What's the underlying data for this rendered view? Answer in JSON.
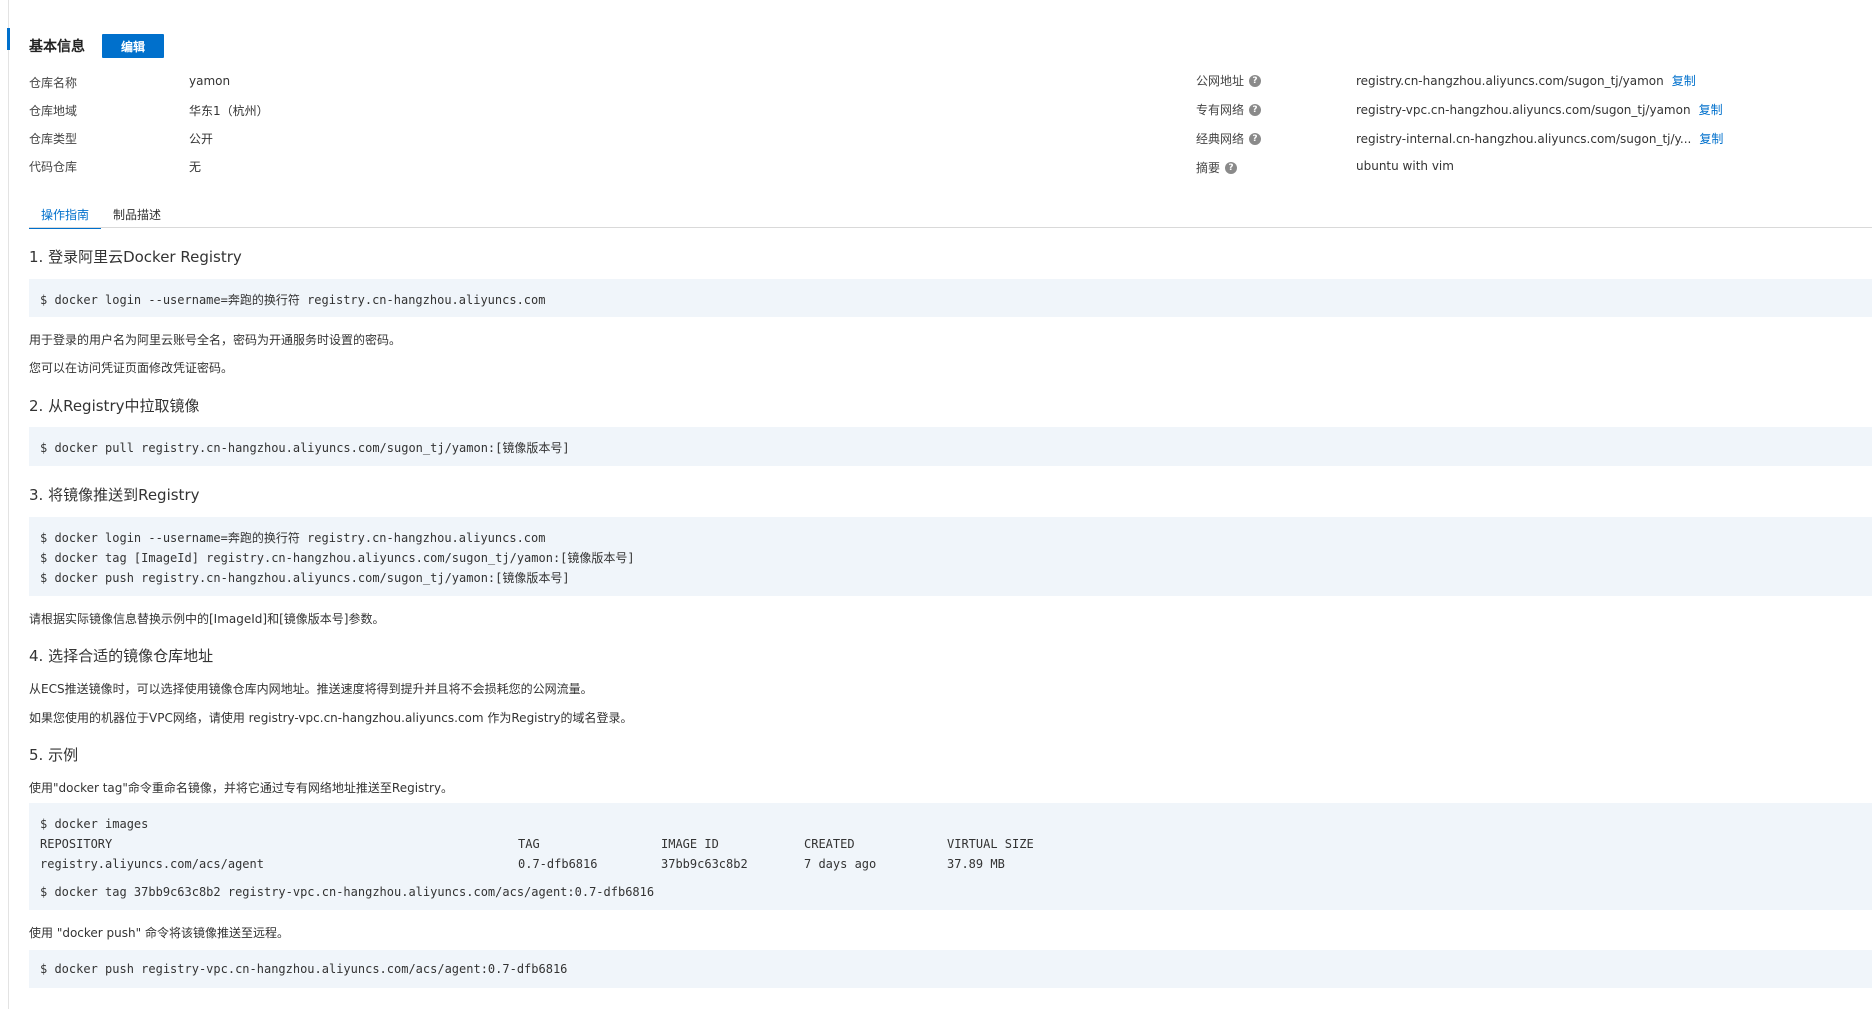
{
  "header": {
    "title": "基本信息",
    "edit_label": "编辑"
  },
  "info_left": [
    {
      "label": "仓库名称",
      "value": "yamon"
    },
    {
      "label": "仓库地域",
      "value": "华东1（杭州）"
    },
    {
      "label": "仓库类型",
      "value": "公开"
    },
    {
      "label": "代码仓库",
      "value": "无"
    }
  ],
  "info_right": [
    {
      "label": "公网地址",
      "value": "registry.cn-hangzhou.aliyuncs.com/sugon_tj/yamon",
      "copy": "复制"
    },
    {
      "label": "专有网络",
      "value": "registry-vpc.cn-hangzhou.aliyuncs.com/sugon_tj/yamon",
      "copy": "复制"
    },
    {
      "label": "经典网络",
      "value": "registry-internal.cn-hangzhou.aliyuncs.com/sugon_tj/y...",
      "copy": "复制"
    },
    {
      "label": "摘要",
      "value": "ubuntu with vim"
    }
  ],
  "help_glyph": "?",
  "tabs": [
    {
      "label": "操作指南"
    },
    {
      "label": "制品描述"
    }
  ],
  "guide": {
    "s1": {
      "title": "1. 登录阿里云Docker Registry",
      "code": "$ docker login --username=奔跑的换行符 registry.cn-hangzhou.aliyuncs.com",
      "p1": "用于登录的用户名为阿里云账号全名，密码为开通服务时设置的密码。",
      "p2": "您可以在访问凭证页面修改凭证密码。"
    },
    "s2": {
      "title": "2. 从Registry中拉取镜像",
      "code": "$ docker pull registry.cn-hangzhou.aliyuncs.com/sugon_tj/yamon:[镜像版本号]"
    },
    "s3": {
      "title": "3. 将镜像推送到Registry",
      "code1": "$ docker login --username=奔跑的换行符 registry.cn-hangzhou.aliyuncs.com",
      "code2": "$ docker tag [ImageId] registry.cn-hangzhou.aliyuncs.com/sugon_tj/yamon:[镜像版本号]",
      "code3": "$ docker push registry.cn-hangzhou.aliyuncs.com/sugon_tj/yamon:[镜像版本号]",
      "p1": "请根据实际镜像信息替换示例中的[ImageId]和[镜像版本号]参数。"
    },
    "s4": {
      "title": "4. 选择合适的镜像仓库地址",
      "p1": "从ECS推送镜像时，可以选择使用镜像仓库内网地址。推送速度将得到提升并且将不会损耗您的公网流量。",
      "p2": "如果您使用的机器位于VPC网络，请使用 registry-vpc.cn-hangzhou.aliyuncs.com 作为Registry的域名登录。"
    },
    "s5": {
      "title": "5. 示例",
      "p1": "使用\"docker tag\"命令重命名镜像，并将它通过专有网络地址推送至Registry。",
      "code_images": "$ docker images",
      "table_headers": [
        "REPOSITORY",
        "TAG",
        "IMAGE ID",
        "CREATED",
        "VIRTUAL SIZE"
      ],
      "table_row": [
        "registry.aliyuncs.com/acs/agent",
        "0.7-dfb6816",
        "37bb9c63c8b2",
        "7 days ago",
        "37.89 MB"
      ],
      "code_tag": "$ docker tag 37bb9c63c8b2 registry-vpc.cn-hangzhou.aliyuncs.com/acs/agent:0.7-dfb6816",
      "p2": "使用 \"docker push\" 命令将该镜像推送至远程。",
      "code_push": "$ docker push registry-vpc.cn-hangzhou.aliyuncs.com/acs/agent:0.7-dfb6816"
    }
  },
  "colors": {
    "accent": "#0070cc",
    "code_bg": "#f0f5fa"
  }
}
